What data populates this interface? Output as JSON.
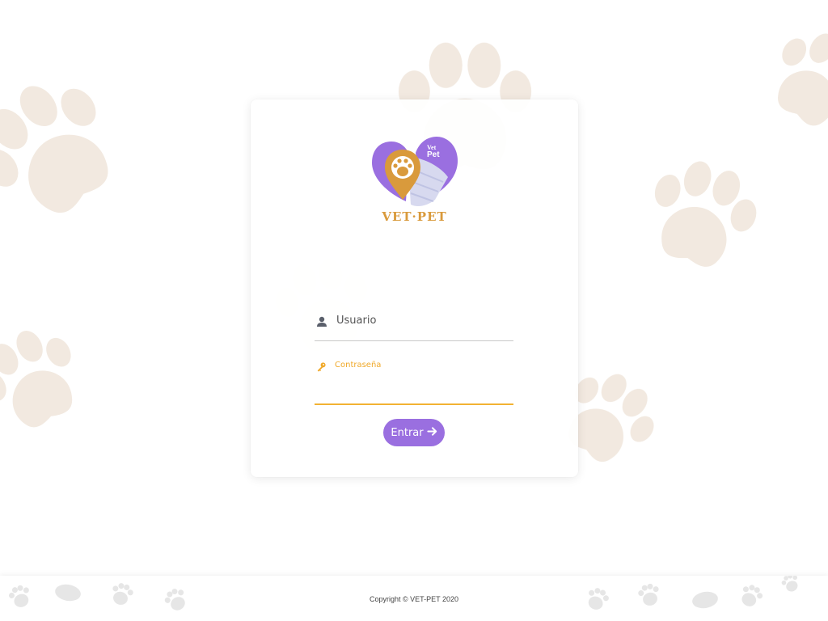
{
  "app": {
    "brand_name": "VET·PET",
    "logo_mark_text_1": "Vet",
    "logo_mark_text_2": "Pet"
  },
  "login": {
    "username_label": "Usuario",
    "password_label": "Contraseña",
    "username_value": "",
    "password_value": "",
    "submit_label": "Entrar",
    "submit_icon": "arrow-right-icon",
    "username_icon": "user-icon",
    "password_icon": "key-icon"
  },
  "footer": {
    "copyright": "Copyright © VET-PET 2020"
  },
  "colors": {
    "accent_purple": "#9a6fe0",
    "accent_orange": "#f0a92a",
    "paw_background": "#ece0d3"
  }
}
